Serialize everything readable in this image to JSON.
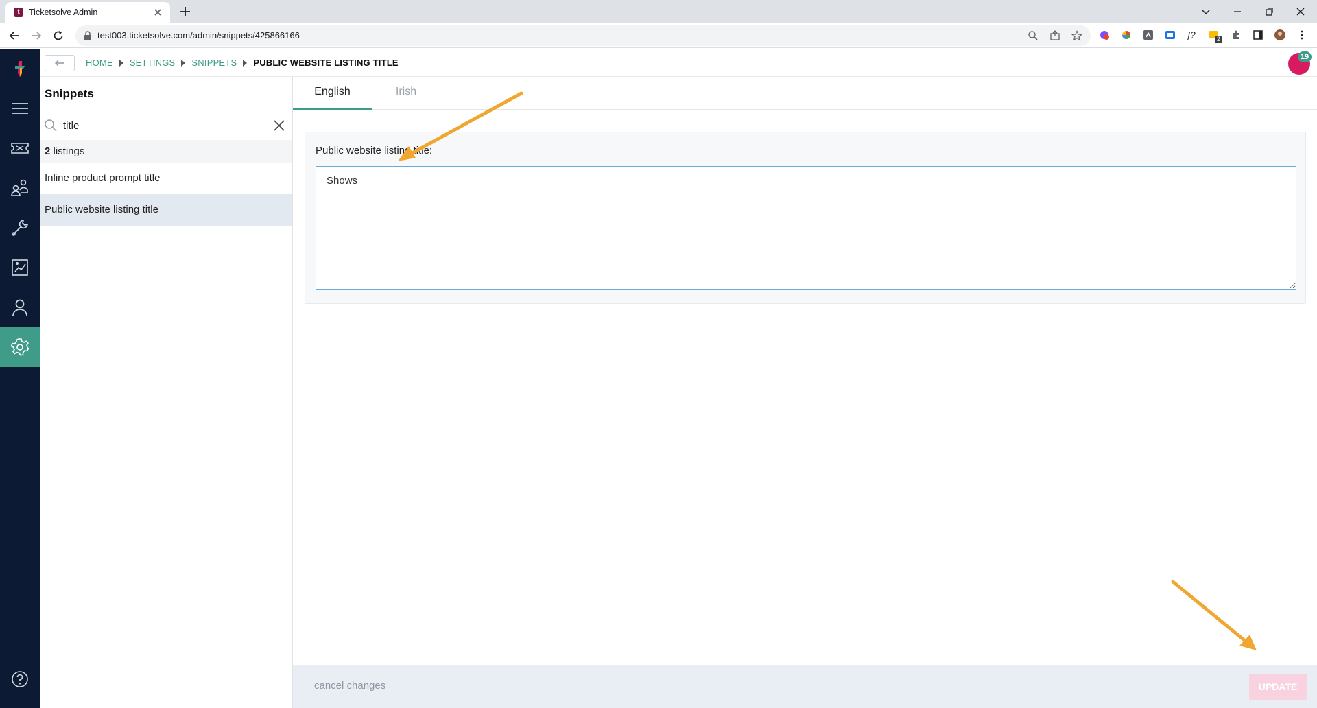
{
  "browser": {
    "tab_title": "Ticketsolve Admin",
    "url": "test003.ticketsolve.com/admin/snippets/425866166",
    "extension_badge": "2"
  },
  "app": {
    "brand_color": "#3f9c88",
    "rail_color": "#0c1b33",
    "accent_pink": "#d81b60",
    "notifications_count": "19",
    "rail_icons": [
      "logo-icon",
      "menu-icon",
      "ticket-icon",
      "customers-icon",
      "tools-icon",
      "reports-icon",
      "user-icon",
      "settings-icon",
      "help-icon"
    ]
  },
  "breadcrumb": {
    "items": [
      "HOME",
      "SETTINGS",
      "SNIPPETS"
    ],
    "current": "PUBLIC WEBSITE LISTING TITLE"
  },
  "snippets": {
    "title": "Snippets",
    "search_value": "title",
    "count_number": "2",
    "count_suffix": " listings",
    "items": [
      {
        "label": "Inline product prompt title",
        "selected": false
      },
      {
        "label": "Public website listing title",
        "selected": true
      }
    ]
  },
  "editor": {
    "tabs": [
      {
        "label": "English",
        "active": true
      },
      {
        "label": "Irish",
        "active": false
      }
    ],
    "field_label": "Public website listing title:",
    "field_value": "Shows"
  },
  "footer": {
    "cancel_label": "cancel changes",
    "update_label": "UPDATE"
  }
}
